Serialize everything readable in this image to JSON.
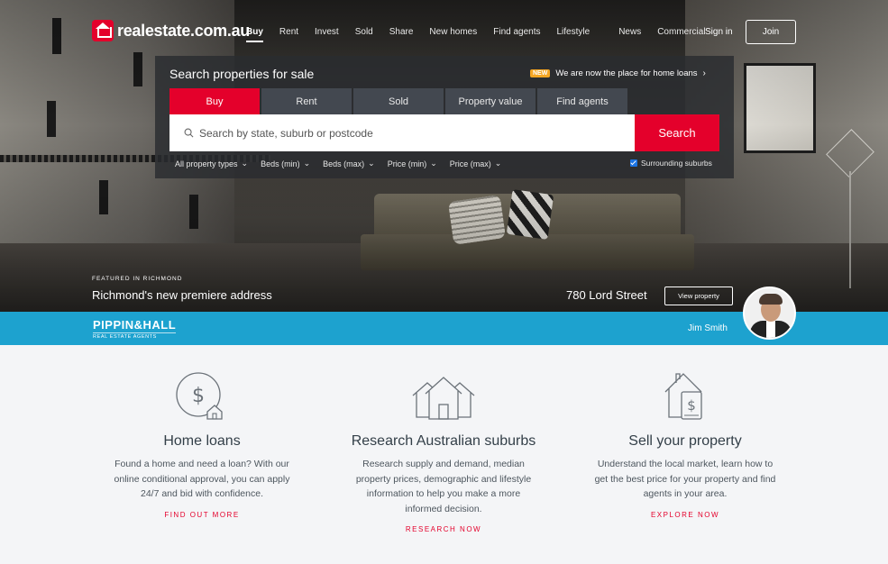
{
  "header": {
    "logo_text": "realestate.com.au",
    "nav": [
      "Buy",
      "Rent",
      "Invest",
      "Sold",
      "Share",
      "New homes",
      "Find agents",
      "Lifestyle",
      "News",
      "Commercial"
    ],
    "sign_in": "Sign in",
    "join": "Join"
  },
  "search": {
    "title": "Search properties for sale",
    "promo_badge": "NEW",
    "promo_text": "We are now the place for home loans",
    "tabs": [
      "Buy",
      "Rent",
      "Sold",
      "Property value",
      "Find agents"
    ],
    "active_tab": "Buy",
    "placeholder": "Search by state, suburb or postcode",
    "button": "Search",
    "filters": [
      "All property types",
      "Beds (min)",
      "Beds (max)",
      "Price (min)",
      "Price (max)"
    ],
    "surrounding_label": "Surrounding suburbs",
    "surrounding_checked": true
  },
  "featured": {
    "kicker": "FEATURED IN RICHMOND",
    "title": "Richmond's new premiere address",
    "address": "780 Lord Street",
    "view_button": "View property",
    "agency_name": "PIPPIN&HALL",
    "agency_sub": "REAL ESTATE AGENTS",
    "agent_name": "Jim Smith",
    "band_color": "#1da2cf"
  },
  "features": [
    {
      "icon": "dollar-house-icon",
      "title": "Home loans",
      "text": "Found a home and need a loan? With our online conditional approval, you can apply 24/7 and bid with confidence.",
      "cta": "FIND OUT MORE"
    },
    {
      "icon": "houses-icon",
      "title": "Research Australian suburbs",
      "text": "Research supply and demand, median property prices, demographic and lifestyle information to help you make a more informed decision.",
      "cta": "RESEARCH NOW"
    },
    {
      "icon": "sell-house-icon",
      "title": "Sell your property",
      "text": "Understand the local market, learn how to get the best price for your property and find agents in your area.",
      "cta": "EXPLORE NOW"
    }
  ],
  "colors": {
    "brand": "#e4002b",
    "accent_blue": "#1da2cf"
  }
}
